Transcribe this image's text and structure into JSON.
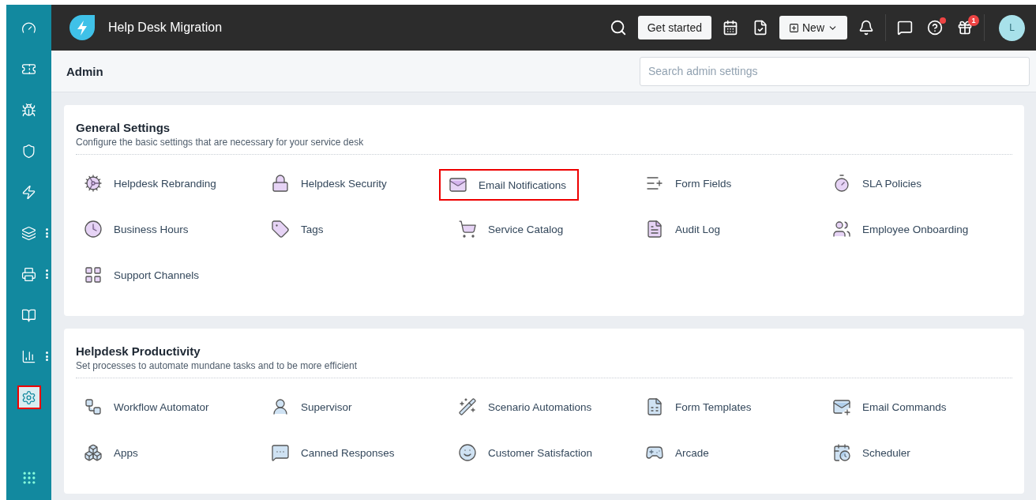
{
  "sidebar": {
    "items": [
      {
        "selected": false,
        "highlighted": false,
        "has_more": false
      },
      {
        "selected": false,
        "highlighted": false,
        "has_more": false
      },
      {
        "selected": false,
        "highlighted": false,
        "has_more": false
      },
      {
        "selected": false,
        "highlighted": false,
        "has_more": false
      },
      {
        "selected": false,
        "highlighted": false,
        "has_more": false
      },
      {
        "selected": false,
        "highlighted": false,
        "has_more": true
      },
      {
        "selected": false,
        "highlighted": false,
        "has_more": true
      },
      {
        "selected": false,
        "highlighted": false,
        "has_more": false
      },
      {
        "selected": false,
        "highlighted": false,
        "has_more": true
      },
      {
        "selected": true,
        "highlighted": true,
        "has_more": false
      }
    ]
  },
  "header": {
    "title": "Help Desk Migration",
    "get_started": "Get started",
    "new_button": "New",
    "help_dot": true,
    "gift_badge": "1",
    "avatar": "L"
  },
  "admin_bar": {
    "title": "Admin",
    "search": {
      "placeholder": "Search admin settings"
    }
  },
  "sections": [
    {
      "title": "General Settings",
      "subtitle": "Configure the basic settings that are necessary for your service desk",
      "items": [
        {
          "label": "Helpdesk Rebranding",
          "highlighted": false
        },
        {
          "label": "Helpdesk Security",
          "highlighted": false
        },
        {
          "label": "Email Notifications",
          "highlighted": true
        },
        {
          "label": "Form Fields",
          "highlighted": false
        },
        {
          "label": "SLA Policies",
          "highlighted": false
        },
        {
          "label": "Business Hours",
          "highlighted": false
        },
        {
          "label": "Tags",
          "highlighted": false
        },
        {
          "label": "Service Catalog",
          "highlighted": false
        },
        {
          "label": "Audit Log",
          "highlighted": false
        },
        {
          "label": "Employee Onboarding",
          "highlighted": false
        },
        {
          "label": "Support Channels",
          "highlighted": false
        }
      ]
    },
    {
      "title": "Helpdesk Productivity",
      "subtitle": "Set processes to automate mundane tasks and to be more efficient",
      "items": [
        {
          "label": "Workflow Automator",
          "highlighted": false
        },
        {
          "label": "Supervisor",
          "highlighted": false
        },
        {
          "label": "Scenario Automations",
          "highlighted": false
        },
        {
          "label": "Form Templates",
          "highlighted": false
        },
        {
          "label": "Email Commands",
          "highlighted": false
        },
        {
          "label": "Apps",
          "highlighted": false
        },
        {
          "label": "Canned Responses",
          "highlighted": false
        },
        {
          "label": "Customer Satisfaction",
          "highlighted": false
        },
        {
          "label": "Arcade",
          "highlighted": false
        },
        {
          "label": "Scheduler",
          "highlighted": false
        }
      ]
    }
  ]
}
